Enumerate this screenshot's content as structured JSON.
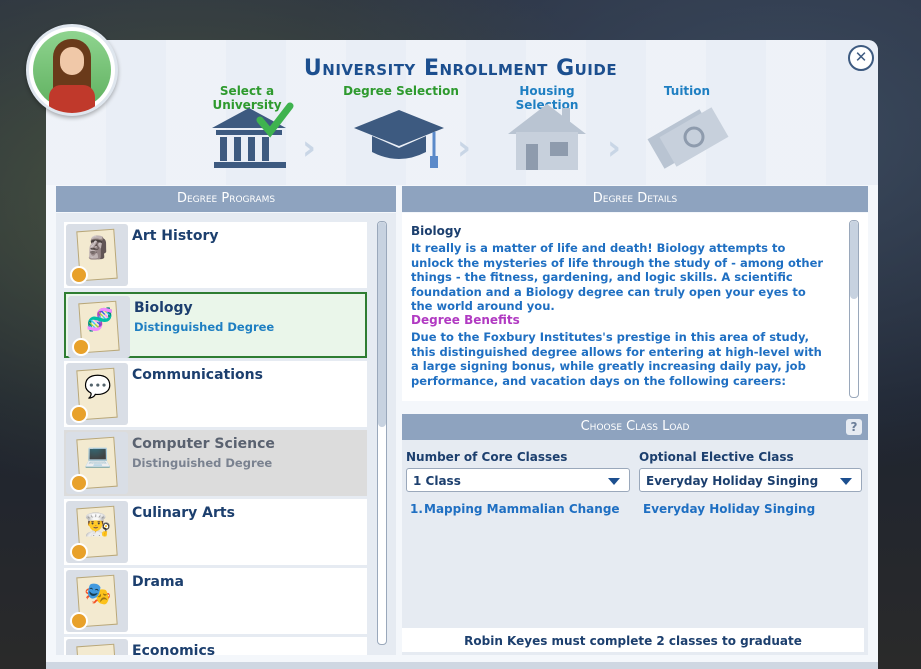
{
  "dialog": {
    "title": "University Enrollment Guide",
    "close_icon": "close-icon"
  },
  "steps": [
    {
      "label": "Select a University",
      "color": "#2e9a2e",
      "icon": "university-building-check-icon"
    },
    {
      "label": "Degree Selection",
      "color": "#2e9a2e",
      "icon": "graduation-cap-icon"
    },
    {
      "label": "Housing Selection",
      "color": "#1f7fc2",
      "icon": "house-icon"
    },
    {
      "label": "Tuition",
      "color": "#1f7fc2",
      "icon": "money-icon"
    }
  ],
  "programs": {
    "header": "Degree Programs",
    "items": [
      {
        "name": "Art History",
        "sub": "",
        "icon": "bust-statue-icon",
        "state": "normal"
      },
      {
        "name": "Biology",
        "sub": "Distinguished Degree",
        "icon": "dna-icon",
        "state": "selected"
      },
      {
        "name": "Communications",
        "sub": "",
        "icon": "speech-bubbles-icon",
        "state": "normal"
      },
      {
        "name": "Computer Science",
        "sub": "Distinguished Degree",
        "icon": "computer-icon",
        "state": "disabled"
      },
      {
        "name": "Culinary Arts",
        "sub": "",
        "icon": "chef-hat-icon",
        "state": "normal"
      },
      {
        "name": "Drama",
        "sub": "",
        "icon": "drama-masks-icon",
        "state": "normal"
      },
      {
        "name": "Economics",
        "sub": "",
        "icon": "economics-icon",
        "state": "normal"
      }
    ]
  },
  "details": {
    "header": "Degree Details",
    "degree_name": "Biology",
    "description": "It really is a matter of life and death! Biology attempts to unlock the mysteries of life through the study of - among other things - the fitness, gardening, and logic skills. A scientific foundation and a Biology degree can truly open your eyes to the world around you.",
    "benefits_title": "Degree Benefits",
    "benefits_text": "Due to the Foxbury Institutes's prestige in this area of study, this distinguished degree allows for entering at high-level with a large signing bonus, while greatly increasing daily pay, job performance, and vacation days on the following careers:"
  },
  "class_load": {
    "header": "Choose Class Load",
    "help_label": "?",
    "core_label": "Number of Core Classes",
    "core_value": "1 Class",
    "elective_label": "Optional Elective Class",
    "elective_value": "Everyday Holiday Singing",
    "core_courses": [
      {
        "num": "1.",
        "name": "Mapping Mammalian Change"
      }
    ],
    "elective_course": "Everyday Holiday Singing",
    "footer": "Robin Keyes must complete 2 classes to graduate"
  }
}
